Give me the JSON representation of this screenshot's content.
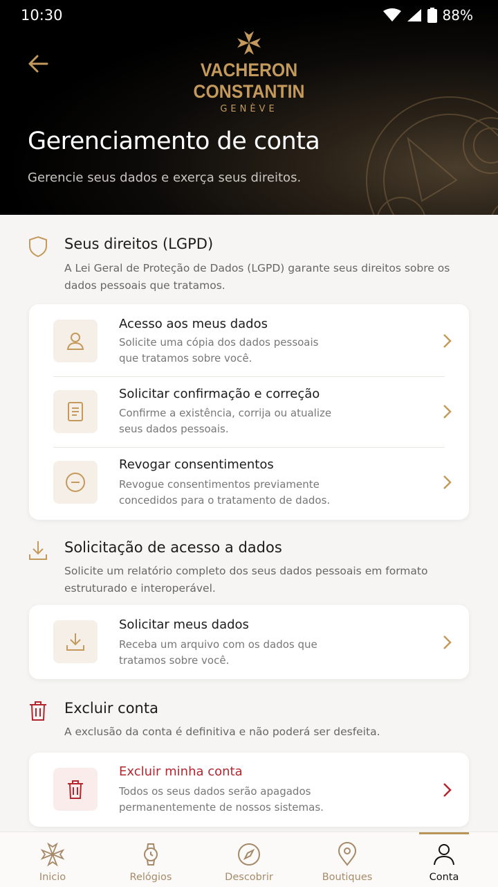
{
  "status": {
    "time": "10:30",
    "battery": "88%"
  },
  "brand": {
    "name": "VACHERON CONSTANTIN",
    "sub": "GENÈVE"
  },
  "header": {
    "title": "Gerenciamento de conta",
    "subtitle": "Gerencie seus dados e exerça seus direitos."
  },
  "sections": {
    "rights": {
      "title": "Seus direitos (LGPD)",
      "desc": "A Lei Geral de Proteção de Dados (LGPD) garante seus direitos sobre os dados pessoais que tratamos.",
      "items": [
        {
          "title": "Acesso aos meus dados",
          "desc": "Solicite uma cópia dos dados pessoais que tratamos sobre você."
        },
        {
          "title": "Solicitar confirmação e correção",
          "desc": "Confirme a existência, corrija ou atualize seus dados pessoais."
        },
        {
          "title": "Revogar consentimentos",
          "desc": "Revogue consentimentos previamente concedidos para o tratamento de dados."
        }
      ]
    },
    "access": {
      "title": "Solicitação de acesso a dados",
      "desc": "Solicite um relatório completo dos seus dados pessoais em formato estruturado e interoperável.",
      "items": [
        {
          "title": "Solicitar meus dados",
          "desc": "Receba um arquivo com os dados que tratamos sobre você."
        }
      ]
    },
    "delete": {
      "title": "Excluir conta",
      "desc": "A exclusão da conta é definitiva e não poderá ser desfeita.",
      "items": [
        {
          "title": "Excluir minha conta",
          "desc": "Todos os seus dados serão apagados permanentemente de nossos sistemas."
        }
      ]
    }
  },
  "nav": {
    "items": [
      {
        "label": "Inicio",
        "icon": "maltese-cross-icon"
      },
      {
        "label": "Relógios",
        "icon": "watch-icon"
      },
      {
        "label": "Descobrir",
        "icon": "compass-icon"
      },
      {
        "label": "Boutiques",
        "icon": "location-pin-icon"
      },
      {
        "label": "Conta",
        "icon": "person-icon",
        "active": true
      }
    ]
  },
  "colors": {
    "accent": "#c39a5c",
    "danger": "#b3262e"
  }
}
